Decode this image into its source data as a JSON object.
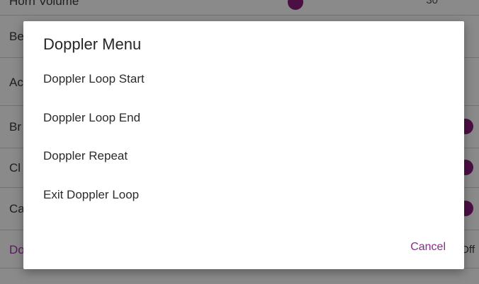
{
  "background": {
    "rows": [
      {
        "label": "Horn Volume",
        "value": "30"
      },
      {
        "label": "Be"
      },
      {
        "label": "Ac"
      },
      {
        "label": "Br"
      },
      {
        "label": "Cl"
      },
      {
        "label": "Ca"
      },
      {
        "label": "Do",
        "value": "Off"
      }
    ],
    "accent_color": "#4b0f43"
  },
  "dialog": {
    "title": "Doppler Menu",
    "items": [
      {
        "label": "Doppler Loop Start"
      },
      {
        "label": "Doppler Loop End"
      },
      {
        "label": "Doppler Repeat"
      },
      {
        "label": "Exit Doppler Loop"
      }
    ],
    "cancel_label": "Cancel",
    "cancel_color": "#8c2a8c"
  }
}
